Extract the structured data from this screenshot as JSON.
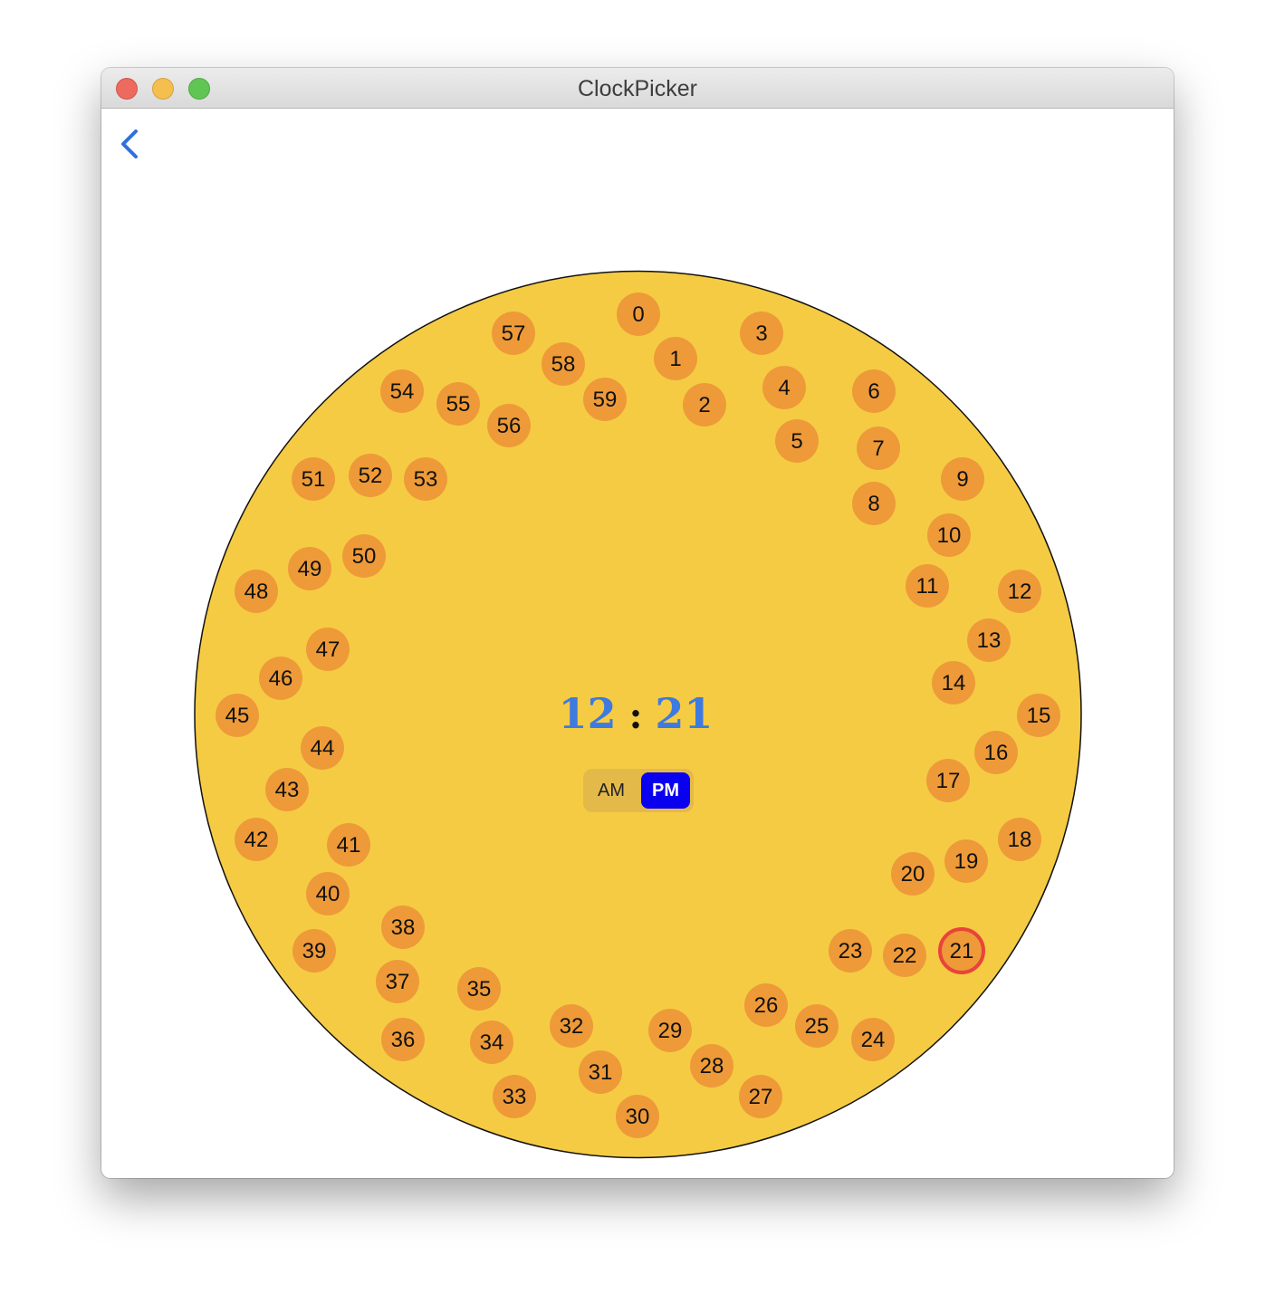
{
  "window": {
    "title": "ClockPicker"
  },
  "nav": {
    "back_icon": "chevron-left-icon"
  },
  "time": {
    "hour": "12",
    "separator": ":",
    "minute": "21"
  },
  "period": {
    "am_label": "AM",
    "pm_label": "PM",
    "selected": "PM"
  },
  "dial": {
    "selected_minute": "21",
    "minute_labels": [
      "0",
      "1",
      "2",
      "3",
      "4",
      "5",
      "6",
      "7",
      "8",
      "9",
      "10",
      "11",
      "12",
      "13",
      "14",
      "15",
      "16",
      "17",
      "18",
      "19",
      "20",
      "21",
      "22",
      "23",
      "24",
      "25",
      "26",
      "27",
      "28",
      "29",
      "30",
      "31",
      "32",
      "33",
      "34",
      "35",
      "36",
      "37",
      "38",
      "39",
      "40",
      "41",
      "42",
      "43",
      "44",
      "45",
      "46",
      "47",
      "48",
      "49",
      "50",
      "51",
      "52",
      "53",
      "54",
      "55",
      "56",
      "57",
      "58",
      "59"
    ]
  },
  "colors": {
    "dial_face": "#f5cb44",
    "minute_bubble": "#ee9a38",
    "selected_ring": "#e8443a",
    "time_digits": "#3e7ae0",
    "pm_active": "#0a00f0",
    "segment_bg": "#e3b94a"
  }
}
